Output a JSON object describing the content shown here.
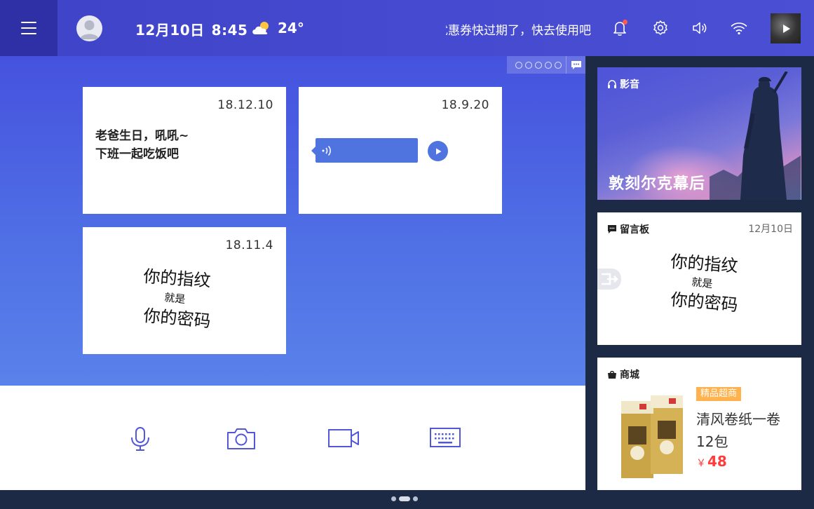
{
  "topbar": {
    "date": "12月10日",
    "time": "8:45",
    "temperature": "24°",
    "marquee": "优惠券快过期了，快去使用吧",
    "icons": [
      "menu-icon",
      "avatar-icon",
      "weather-partly-sunny-icon",
      "bell-icon",
      "gear-icon",
      "volume-icon",
      "wifi-icon",
      "play-icon"
    ]
  },
  "board": {
    "notes": [
      {
        "date": "18.12.10",
        "type": "text",
        "text_line1": "老爸生日，吼吼~",
        "text_line2": "下班一起吃饭吧"
      },
      {
        "date": "18.9.20",
        "type": "voice"
      },
      {
        "date": "18.11.4",
        "type": "handwriting",
        "handwriting_line1": "你的指纹",
        "handwriting_line2": "就是",
        "handwriting_line3": "你的密码"
      }
    ]
  },
  "inputbar": {
    "icons": [
      "microphone-icon",
      "camera-icon",
      "video-camera-icon",
      "keyboard-icon"
    ]
  },
  "side": {
    "video": {
      "label": "影音",
      "title": "敦刻尔克幕后"
    },
    "message": {
      "label": "留言板",
      "date": "12月10日",
      "handwriting_line1": "你的指纹",
      "handwriting_line2": "就是",
      "handwriting_line3": "你的密码"
    },
    "shop": {
      "label": "商城",
      "tag": "精品超商",
      "name": "清风卷纸一卷12包",
      "currency": "￥",
      "price": "48"
    }
  },
  "colors": {
    "topbar": "#4549cf",
    "menu": "#2f2fa6",
    "accent": "#4f74e0",
    "price": "#ff3b3b",
    "tag": "#ffb24d",
    "background": "#1d2a45"
  }
}
